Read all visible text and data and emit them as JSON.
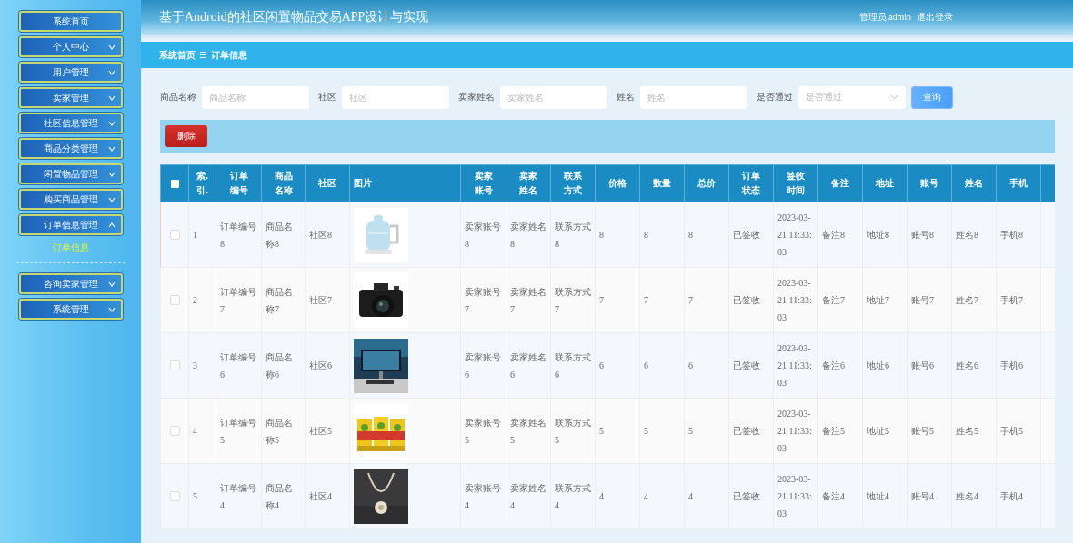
{
  "header": {
    "title": "基于Android的社区闲置物品交易APP设计与实现",
    "user": "管理员 admin",
    "logout": "退出登录"
  },
  "sidebar": {
    "items": [
      {
        "label": "系统首页",
        "kind": "link"
      },
      {
        "label": "个人中心",
        "kind": "menu",
        "expanded": false
      },
      {
        "label": "用户管理",
        "kind": "menu",
        "expanded": false
      },
      {
        "label": "卖家管理",
        "kind": "menu",
        "expanded": false
      },
      {
        "label": "社区信息管理",
        "kind": "menu",
        "expanded": false
      },
      {
        "label": "商品分类管理",
        "kind": "menu",
        "expanded": false
      },
      {
        "label": "闲置物品管理",
        "kind": "menu",
        "expanded": false
      },
      {
        "label": "购买商品管理",
        "kind": "menu",
        "expanded": false
      },
      {
        "label": "订单信息管理",
        "kind": "menu",
        "expanded": true,
        "children": [
          {
            "label": "订单信息",
            "selected": true
          }
        ]
      },
      {
        "label": "咨询卖家管理",
        "kind": "menu",
        "expanded": false
      },
      {
        "label": "系统管理",
        "kind": "menu",
        "expanded": false
      }
    ]
  },
  "breadcrumb": [
    "系统首页",
    "订单信息"
  ],
  "search": {
    "fields": [
      {
        "label": "商品名称",
        "placeholder": "商品名称",
        "kind": "text"
      },
      {
        "label": "社区",
        "placeholder": "社区",
        "kind": "text"
      },
      {
        "label": "卖家姓名",
        "placeholder": "卖家姓名",
        "kind": "text"
      },
      {
        "label": "姓名",
        "placeholder": "姓名",
        "kind": "text"
      },
      {
        "label": "是否通过",
        "placeholder": "是否通过",
        "kind": "select"
      }
    ],
    "button": "查询"
  },
  "toolbar": {
    "delete_button": "删除"
  },
  "table": {
    "columns": [
      {
        "kind": "checkbox",
        "checked": false
      },
      "索.引.",
      "订单编号",
      "商品名称",
      "社区",
      "图片",
      "卖家账号",
      "卖家姓名",
      "联系方式",
      "价格",
      "数量",
      "总价",
      "订单状态",
      "签收时间",
      "备注",
      "地址",
      "账号",
      "姓名",
      "手机"
    ],
    "rows": [
      {
        "cells": [
          {
            "kind": "checkbox",
            "checked": false
          },
          "1",
          "订单编号8",
          "商品名称8",
          "社区8",
          {
            "kind": "picture"
          },
          "卖家账号8",
          "卖家姓名8",
          "联系方式8",
          "8",
          "8",
          "8",
          "已签收",
          "2023-03-21 11:33:03",
          "备注8",
          "地址8",
          "账号8",
          "姓名8",
          "手机8"
        ]
      },
      {
        "cells": [
          {
            "kind": "checkbox",
            "checked": false
          },
          "2",
          "订单编号7",
          "商品名称7",
          "社区7",
          {
            "kind": "picture"
          },
          "卖家账号7",
          "卖家姓名7",
          "联系方式7",
          "7",
          "7",
          "7",
          "已签收",
          "2023-03-21 11:33:03",
          "备注7",
          "地址7",
          "账号7",
          "姓名7",
          "手机7"
        ]
      },
      {
        "cells": [
          {
            "kind": "checkbox",
            "checked": false
          },
          "3",
          "订单编号6",
          "商品名称6",
          "社区6",
          {
            "kind": "picture"
          },
          "卖家账号6",
          "卖家姓名6",
          "联系方式6",
          "6",
          "6",
          "6",
          "已签收",
          "2023-03-21 11:33:03",
          "备注6",
          "地址6",
          "账号6",
          "姓名6",
          "手机6"
        ]
      },
      {
        "cells": [
          {
            "kind": "checkbox",
            "checked": false
          },
          "4",
          "订单编号5",
          "商品名称5",
          "社区5",
          {
            "kind": "picture"
          },
          "卖家账号5",
          "卖家姓名5",
          "联系方式5",
          "5",
          "5",
          "5",
          "已签收",
          "2023-03-21 11:33:03",
          "备注5",
          "地址5",
          "账号5",
          "姓名5",
          "手机5"
        ]
      },
      {
        "cells": [
          {
            "kind": "checkbox",
            "checked": false
          },
          "5",
          "订单编号4",
          "商品名称4",
          "社区4",
          {
            "kind": "picture"
          },
          "卖家账号4",
          "卖家姓名4",
          "联系方式4",
          "4",
          "4",
          "4",
          "已签收",
          "2023-03-21 11:33:03",
          "备注4",
          "地址4",
          "账号4",
          "姓名4",
          "手机4"
        ]
      }
    ]
  }
}
